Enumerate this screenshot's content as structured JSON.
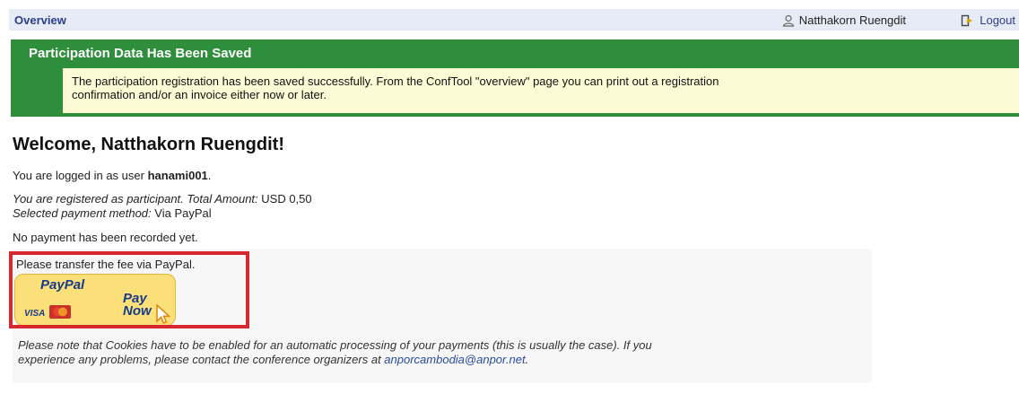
{
  "header": {
    "overview_label": "Overview",
    "user_name": "Natthakorn Ruengdit",
    "logout_label": "Logout"
  },
  "notice": {
    "title": "Participation Data Has Been Saved",
    "message_line1": "The participation registration has been saved successfully. From the ConfTool \"overview\" page you can print out a registration",
    "message_line2": "confirmation and/or an invoice either now or later."
  },
  "main": {
    "welcome": "Welcome, Natthakorn Ruengdit!",
    "logged_in_prefix": "You are logged in as user ",
    "username": "hanami001",
    "logged_in_suffix": ".",
    "registered_text": "You are registered as participant. Total Amount:",
    "total_amount": "USD 0,50",
    "payment_method_label": "Selected payment method:",
    "payment_method": "Via PayPal",
    "payment_status": "No payment has been recorded yet.",
    "transfer_instruction": "Please transfer the fee via PayPal."
  },
  "paypal_button": {
    "logo_text": "PayPal",
    "card_text": "VISA",
    "pay_label": "Pay",
    "now_label": "Now"
  },
  "note": {
    "text_line1": "Please note that Cookies have to be enabled for an automatic processing of your payments (this is usually the case). If you",
    "text_line2": "experience any problems, please contact the conference organizers at ",
    "email": "anporcambodia@anpor.net",
    "text_end": "."
  },
  "colors": {
    "header_bg": "#e6ebf6",
    "notice_green": "#2f8e3b",
    "notice_yellow": "#fdfbd6",
    "highlight_red": "#d8282f",
    "paypal_yellow": "#fbe07a"
  }
}
